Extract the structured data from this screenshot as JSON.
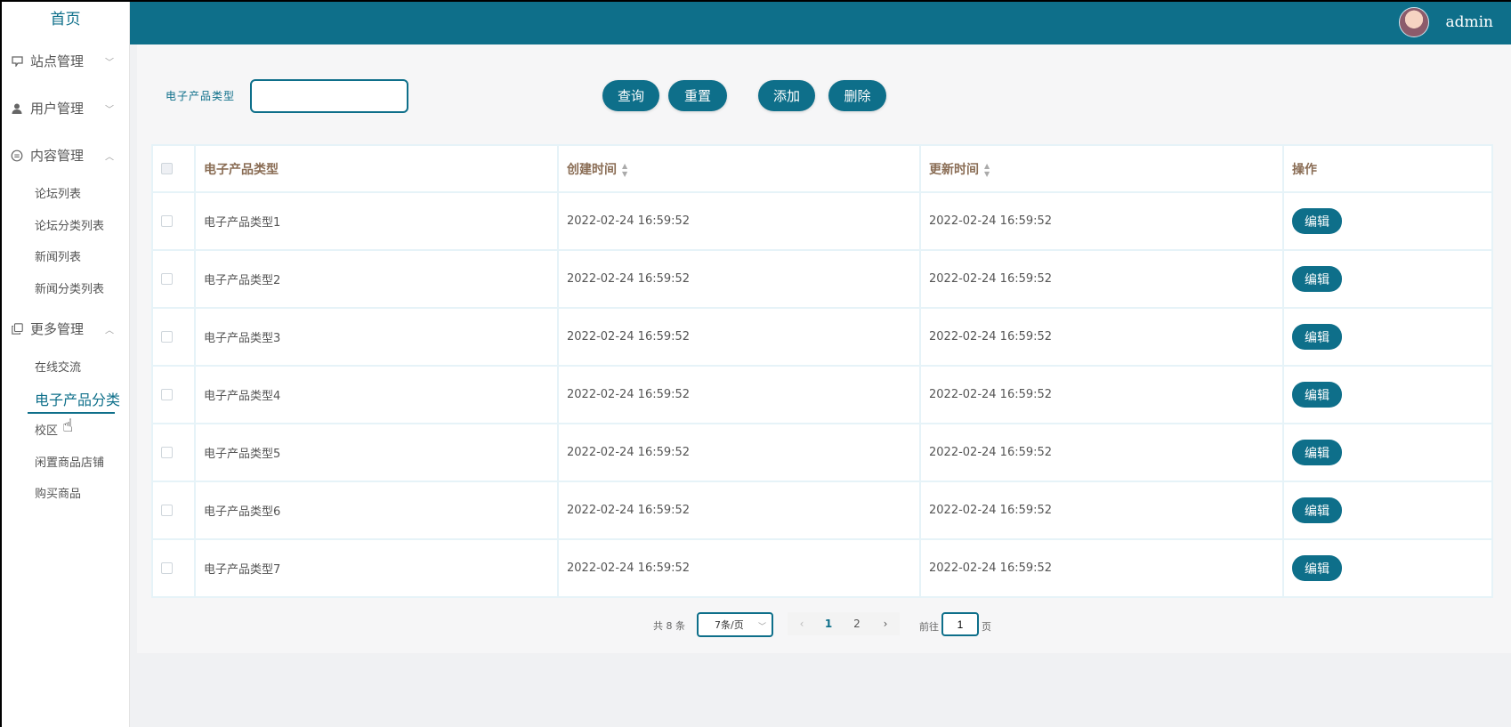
{
  "sidebar": {
    "home": "首页",
    "groups": [
      {
        "label": "站点管理",
        "icon": "monitor-icon"
      },
      {
        "label": "用户管理",
        "icon": "user-icon"
      },
      {
        "label": "内容管理",
        "icon": "message-icon"
      },
      {
        "label": "更多管理",
        "icon": "copy-icon"
      }
    ],
    "content_items": [
      "论坛列表",
      "论坛分类列表",
      "新闻列表",
      "新闻分类列表"
    ],
    "more_items": [
      "在线交流",
      "电子产品分类",
      "校区",
      "闲置商品店铺",
      "购买商品"
    ]
  },
  "header": {
    "username": "admin"
  },
  "search": {
    "label": "电子产品类型",
    "value": ""
  },
  "buttons": {
    "query": "查询",
    "reset": "重置",
    "add": "添加",
    "delete": "删除"
  },
  "table": {
    "headers": [
      "电子产品类型",
      "创建时间",
      "更新时间",
      "操作"
    ],
    "rows": [
      {
        "type": "电子产品类型1",
        "created": "2022-02-24 16:59:52",
        "updated": "2022-02-24 16:59:52",
        "action": "编辑"
      },
      {
        "type": "电子产品类型2",
        "created": "2022-02-24 16:59:52",
        "updated": "2022-02-24 16:59:52",
        "action": "编辑"
      },
      {
        "type": "电子产品类型3",
        "created": "2022-02-24 16:59:52",
        "updated": "2022-02-24 16:59:52",
        "action": "编辑"
      },
      {
        "type": "电子产品类型4",
        "created": "2022-02-24 16:59:52",
        "updated": "2022-02-24 16:59:52",
        "action": "编辑"
      },
      {
        "type": "电子产品类型5",
        "created": "2022-02-24 16:59:52",
        "updated": "2022-02-24 16:59:52",
        "action": "编辑"
      },
      {
        "type": "电子产品类型6",
        "created": "2022-02-24 16:59:52",
        "updated": "2022-02-24 16:59:52",
        "action": "编辑"
      },
      {
        "type": "电子产品类型7",
        "created": "2022-02-24 16:59:52",
        "updated": "2022-02-24 16:59:52",
        "action": "编辑"
      }
    ]
  },
  "pagination": {
    "total": "共 8 条",
    "page_size": "7条/页",
    "pages": [
      "1",
      "2"
    ],
    "current_page": "1",
    "goto_label": "前往",
    "goto_value": "1",
    "page_suffix": "页"
  },
  "colors": {
    "primary": "#0e6f8a",
    "header_text": "#8a6d55",
    "background": "#f0f1f3"
  }
}
